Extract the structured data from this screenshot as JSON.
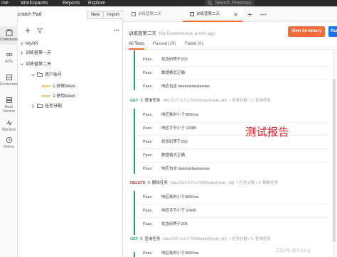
{
  "topbar": {
    "menu_items": [
      "me",
      "Workspaces",
      "Reports",
      "Explore"
    ],
    "search_placeholder": "Search Postman"
  },
  "rail": {
    "items": [
      {
        "label": "Collections",
        "icon": "collections-icon",
        "active": true
      },
      {
        "label": "APIs",
        "icon": "apis-icon"
      },
      {
        "label": "Environments",
        "icon": "environments-icon"
      },
      {
        "label": "Mock Servers",
        "icon": "mock-servers-icon"
      },
      {
        "label": "Monitors",
        "icon": "monitors-icon"
      },
      {
        "label": "History",
        "icon": "history-icon"
      }
    ]
  },
  "sidebar": {
    "workspace_name": "cratch Pad",
    "new_label": "New",
    "import_label": "Import",
    "tree": [
      {
        "label": "MyAPI",
        "type": "collection",
        "depth": 0
      },
      {
        "label": "训练营第一天",
        "type": "collection",
        "depth": 0
      },
      {
        "label": "训练营第二天",
        "type": "collection",
        "depth": 0
      },
      {
        "label": "用户账号",
        "type": "folder",
        "depth": 1
      },
      {
        "label": "1.获取token",
        "type": "request",
        "method": "POST",
        "depth": 2
      },
      {
        "label": "2.使用token",
        "type": "request",
        "method": "POST",
        "depth": 2
      },
      {
        "label": "任务分配",
        "type": "folder",
        "depth": 1
      }
    ]
  },
  "tabs": [
    {
      "label": "训练营第二天",
      "active": false
    },
    {
      "label": "训练营第二天",
      "active": true
    }
  ],
  "run": {
    "title": "训练营第二天",
    "subtitle": "No Environment, a min ago",
    "view_summary": "View Summary",
    "run_again": "Run"
  },
  "filters": [
    "All Tests",
    "Passed (29)",
    "Failed (0)"
  ],
  "results": [
    {
      "kind": "assert",
      "status": "Pass",
      "text": "状态码等于200"
    },
    {
      "kind": "assert",
      "status": "Pass",
      "text": "数据格式正确"
    },
    {
      "kind": "assert",
      "status": "Pass",
      "text": "响应包含 dasdasdasdasdas"
    },
    {
      "kind": "request",
      "method": "GET",
      "name": "3. 查询任务",
      "url": "http://127.0.0.1:7600/todo/{{todo_id}}",
      "path": "/ 任务分配 / 3. 查询任务"
    },
    {
      "kind": "assert",
      "status": "Pass",
      "text": "响应耗时小于3000ms"
    },
    {
      "kind": "assert",
      "status": "Pass",
      "text": "响应字节小于 10MB"
    },
    {
      "kind": "assert",
      "status": "Pass",
      "text": "状态码等于200"
    },
    {
      "kind": "assert",
      "status": "Pass",
      "text": "数据格式正确"
    },
    {
      "kind": "assert",
      "status": "Pass",
      "text": "响应包含 dasdasdasdasdas"
    },
    {
      "kind": "request",
      "method": "DELETE",
      "name": "4. 删除任务",
      "url": "http://127.0.0.1:7600/todo/{{todo_id}}",
      "path": "/ 任务分配 / 4. 删除任务"
    },
    {
      "kind": "assert",
      "status": "Pass",
      "text": "响应耗时小于3000ms"
    },
    {
      "kind": "assert",
      "status": "Pass",
      "text": "响应字节小于 10MB"
    },
    {
      "kind": "assert",
      "status": "Pass",
      "text": "状态码等于204"
    },
    {
      "kind": "request",
      "method": "GET",
      "name": "5. 查询任务",
      "url": "http://127.0.0.1:7600/todo/{{todo_id}}",
      "path": "/ 任务分配 / 5. 查询任务"
    },
    {
      "kind": "assert",
      "status": "Pass",
      "text": "响应耗时小于3000ms"
    }
  ],
  "overlay_text": "测试报告",
  "watermark": "CSDN @XXX-jj",
  "colors": {
    "accent": "#f26b3a",
    "get": "#26a269",
    "delete": "#d0342c",
    "post": "#c4a000",
    "overlay": "#e8101a"
  }
}
